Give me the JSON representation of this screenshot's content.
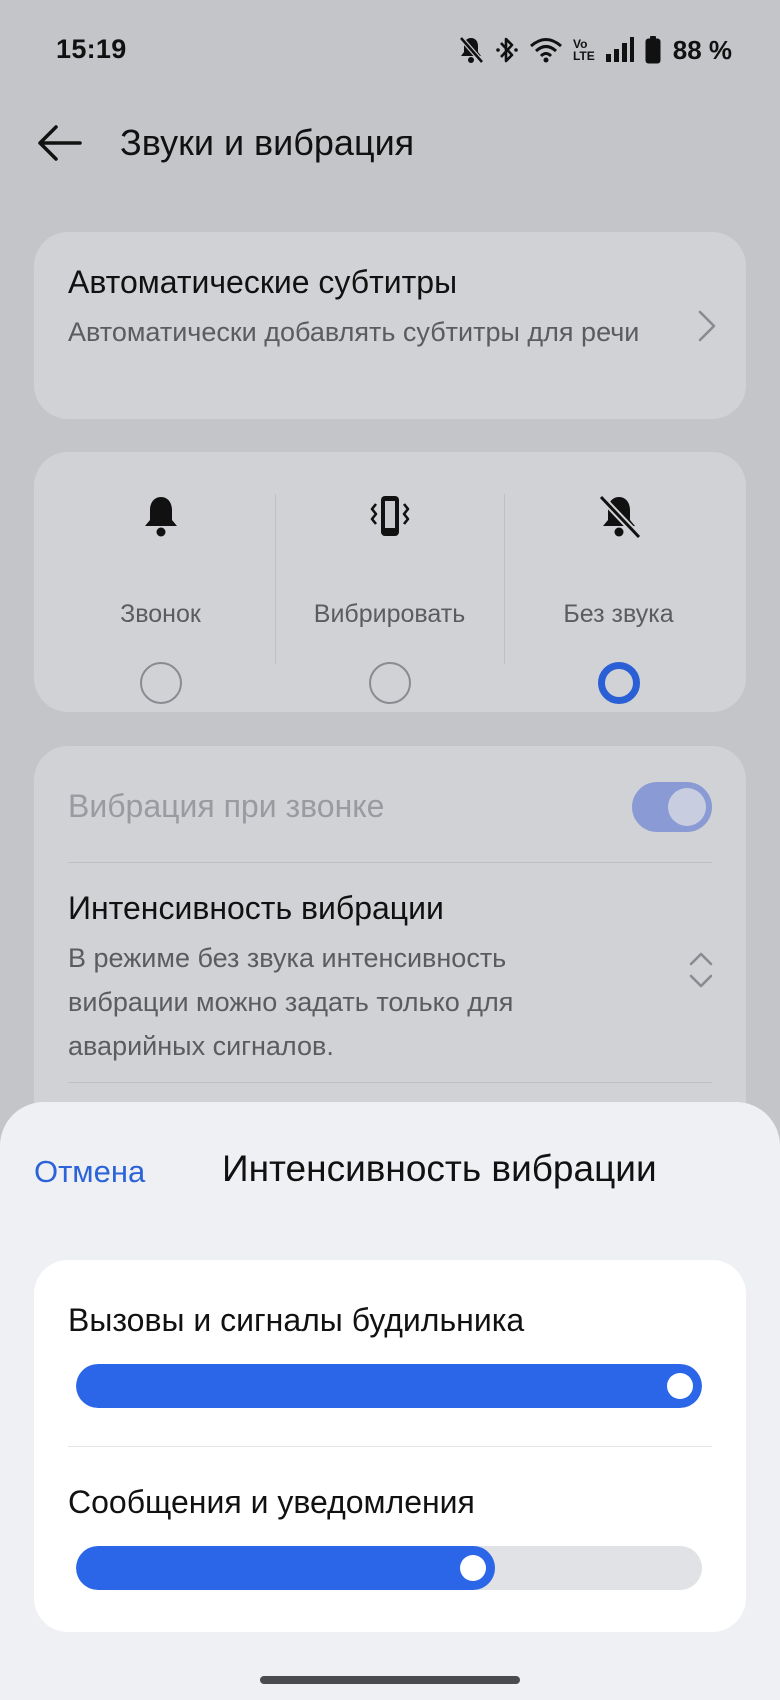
{
  "status_bar": {
    "time": "15:19",
    "battery_percent": "88 %",
    "battery_level": 0.88,
    "icons": [
      "mute-bell-icon",
      "bluetooth-icon",
      "wifi-icon",
      "volte-icon",
      "signal-icon",
      "battery-icon"
    ],
    "volte_line1": "Vo",
    "volte_line2": "LTE"
  },
  "app_bar": {
    "title": "Звуки и вибрация",
    "back_icon": "arrow-left-icon"
  },
  "subtitles_card": {
    "title": "Автоматические субтитры",
    "description": "Автоматически добавлять субтитры для речи"
  },
  "sound_modes": {
    "items": [
      {
        "label": "Звонок",
        "icon": "bell-icon",
        "selected": false
      },
      {
        "label": "Вибрировать",
        "icon": "vibrate-phone-icon",
        "selected": false
      },
      {
        "label": "Без звука",
        "icon": "bell-off-icon",
        "selected": true
      }
    ]
  },
  "vibration_card": {
    "vibrate_on_ring_label": "Вибрация при звонке",
    "vibrate_on_ring_enabled": true,
    "intensity_title": "Интенсивность вибрации",
    "intensity_description": "В режиме без звука интенсивность вибрации можно задать только для аварийных сигналов."
  },
  "sheet": {
    "cancel_label": "Отмена",
    "title": "Интенсивность вибрации",
    "sliders": [
      {
        "label": "Вызовы и сигналы будильника",
        "value": 1.0
      },
      {
        "label": "Сообщения и уведомления",
        "value": 0.67
      }
    ]
  },
  "colors": {
    "accent": "#2b63d8",
    "slider_fill": "#2b66e8",
    "dim_background": "#c4c5c8",
    "sheet_background": "#eff0f3"
  }
}
